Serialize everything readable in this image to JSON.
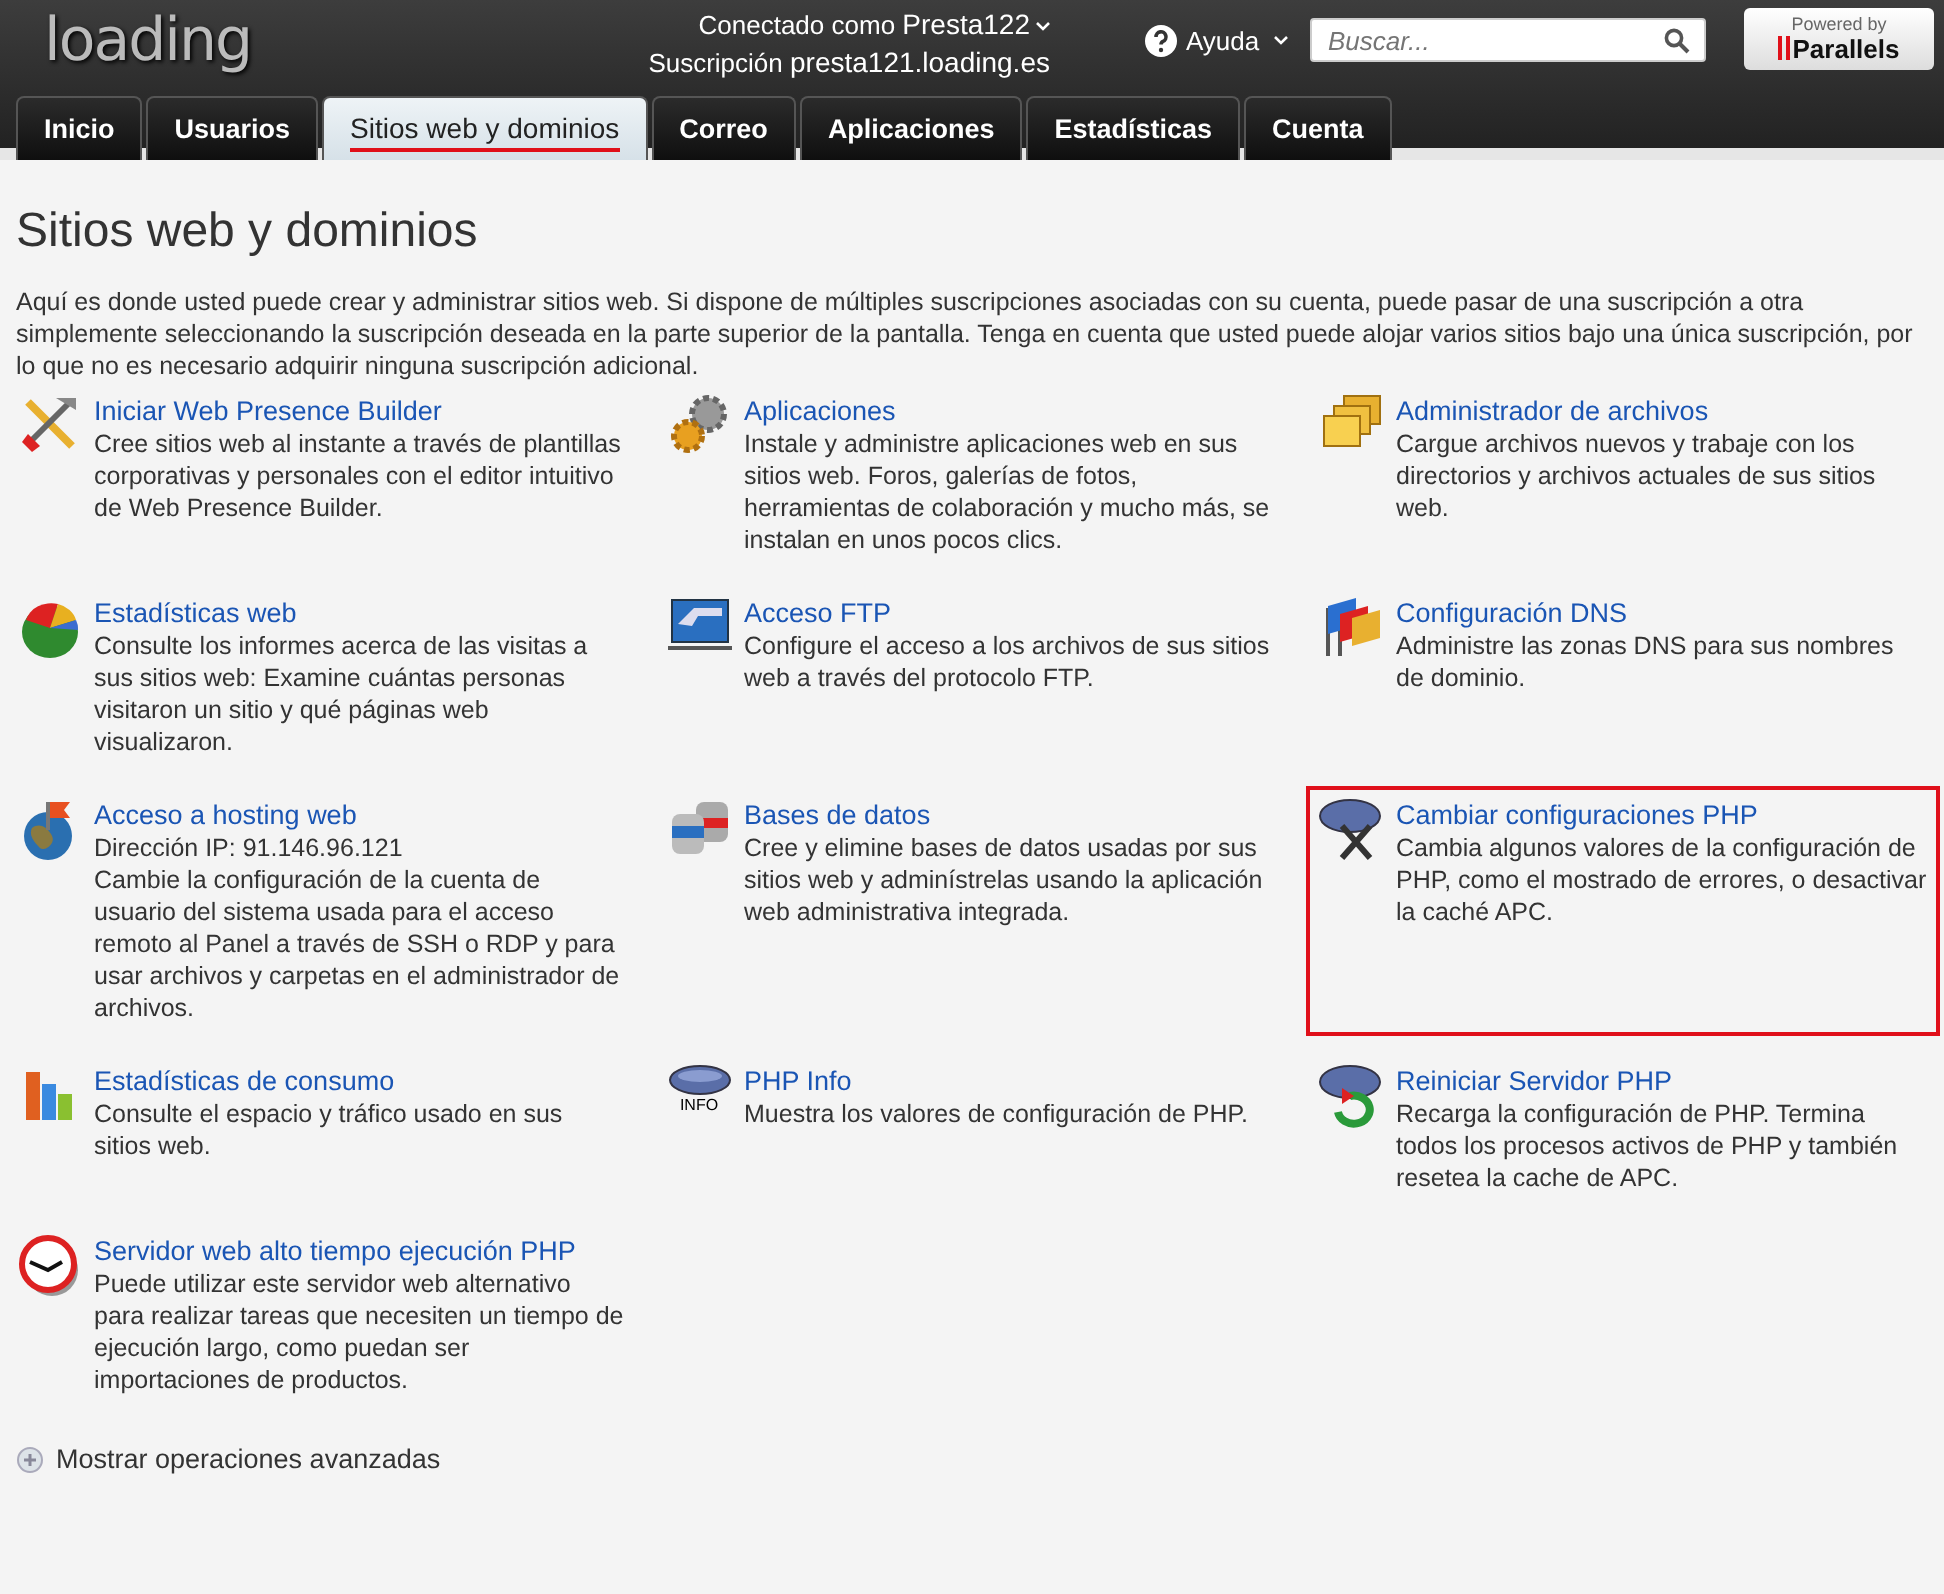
{
  "header": {
    "logo": "loading",
    "user_label": "Conectado como",
    "user": "Presta122",
    "subscription_label": "Suscripción",
    "subscription": "presta121.loading.es",
    "help": "Ayuda",
    "search": {
      "placeholder": "Buscar..."
    },
    "powered_by": "Powered by",
    "brand": "Parallels"
  },
  "tabs": [
    {
      "label": "Inicio",
      "selected": false
    },
    {
      "label": "Usuarios",
      "selected": false
    },
    {
      "label": "Sitios web y dominios",
      "selected": true
    },
    {
      "label": "Correo",
      "selected": false
    },
    {
      "label": "Aplicaciones",
      "selected": false
    },
    {
      "label": "Estadísticas",
      "selected": false
    },
    {
      "label": "Cuenta",
      "selected": false
    }
  ],
  "page": {
    "title": "Sitios web y dominios",
    "intro": "Aquí es donde usted puede crear y administrar sitios web. Si dispone de múltiples suscripciones asociadas con su cuenta, puede pasar de una suscripción a otra simplemente seleccionando la suscripción deseada en la parte superior de la pantalla. Tenga en cuenta que usted puede alojar varios sitios bajo una única suscripción, por lo que no es necesario adquirir ninguna suscripción adicional."
  },
  "tools": [
    {
      "title": "Iniciar Web Presence Builder",
      "description": "Cree sitios web al instante a través de plantillas corporativas y personales con el editor intuitivo de Web Presence Builder.",
      "highlighted": false
    },
    {
      "title": "Aplicaciones",
      "description": "Instale y administre aplicaciones web en sus sitios web. Foros, galerías de fotos, herramientas de colaboración y mucho más, se instalan en unos pocos clics.",
      "highlighted": false
    },
    {
      "title": "Administrador de archivos",
      "description": "Cargue archivos nuevos y trabaje con los directorios y archivos actuales de sus sitios web.",
      "highlighted": false
    },
    {
      "title": "Estadísticas web",
      "description": "Consulte los informes acerca de las visitas a sus sitios web: Examine cuántas personas visitaron un sitio y qué páginas web visualizaron.",
      "highlighted": false
    },
    {
      "title": "Acceso FTP",
      "description": "Configure el acceso a los archivos de sus sitios web a través del protocolo FTP.",
      "highlighted": false
    },
    {
      "title": "Configuración DNS",
      "description": "Administre las zonas DNS para sus nombres de dominio.",
      "highlighted": false
    },
    {
      "title": "Acceso a hosting web",
      "detail": "Dirección IP: 91.146.96.121",
      "description": "Cambie la configuración de la cuenta de usuario del sistema usada para el acceso remoto al Panel a través de SSH o RDP y para usar archivos y carpetas en el administrador de archivos.",
      "highlighted": false
    },
    {
      "title": "Bases de datos",
      "description": "Cree y elimine bases de datos usadas por sus sitios web y adminístrelas usando la aplicación web administrativa integrada.",
      "highlighted": false
    },
    {
      "title": "Cambiar configuraciones PHP",
      "description": "Cambia algunos valores de la configuración de PHP, como el mostrado de errores, o desactivar la caché APC.",
      "highlighted": true
    },
    {
      "title": "Estadísticas de consumo",
      "description": "Consulte el espacio y tráfico usado en sus sitios web.",
      "highlighted": false
    },
    {
      "title": "PHP Info",
      "icon_label": "INFO",
      "description": "Muestra los valores de configuración de PHP.",
      "highlighted": false
    },
    {
      "title": "Reiniciar Servidor PHP",
      "description": "Recarga la configuración de PHP. Termina todos los procesos activos de PHP y también resetea la cache de APC.",
      "highlighted": false
    },
    {
      "title": "Servidor web alto tiempo ejecución PHP",
      "description": "Puede utilizar este servidor web alternativo para realizar tareas que necesiten un tiempo de ejecución largo, como puedan ser importaciones de productos.",
      "highlighted": false
    }
  ],
  "advanced_link": "Mostrar operaciones avanzadas"
}
